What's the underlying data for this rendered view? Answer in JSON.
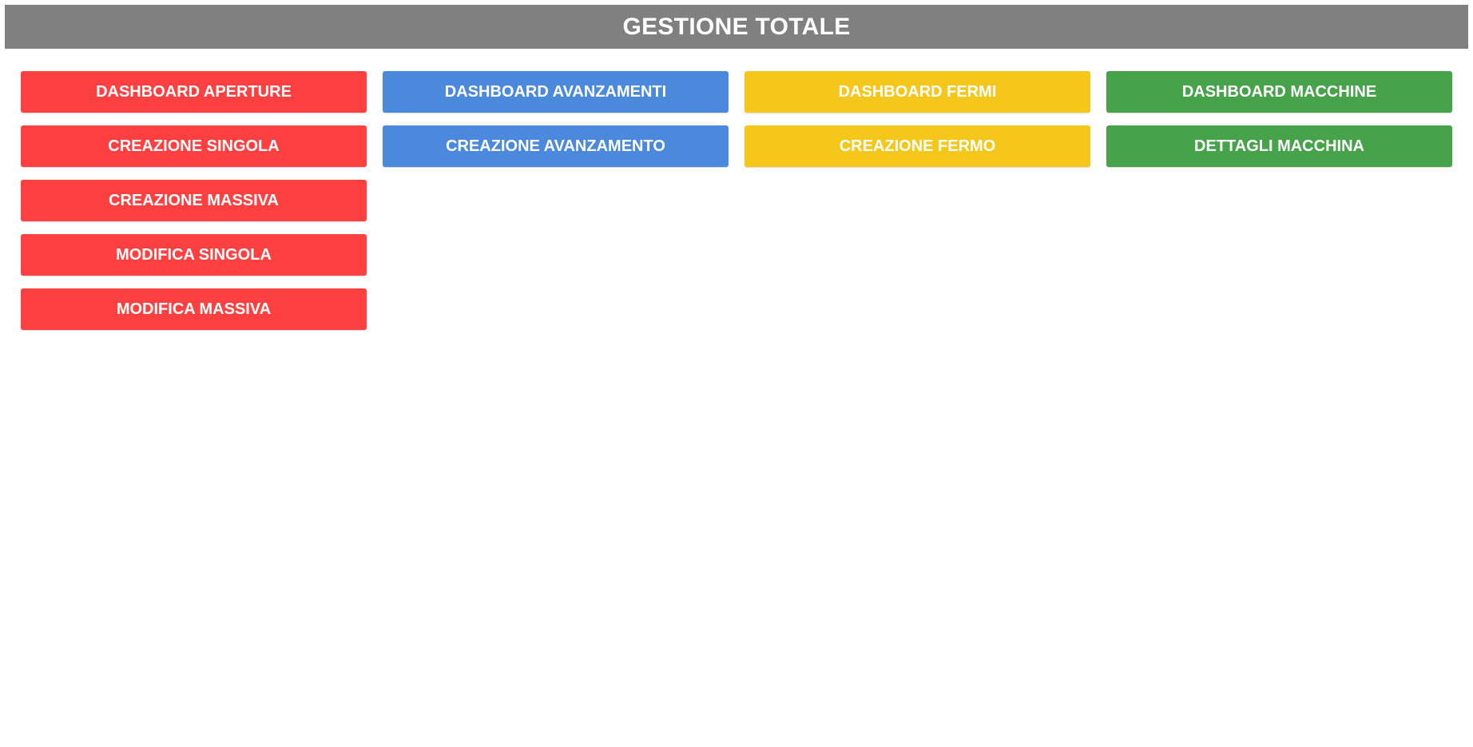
{
  "header": {
    "title": "GESTIONE TOTALE",
    "color": "#808080"
  },
  "columns": [
    {
      "color": "#ff4040",
      "buttons": [
        "DASHBOARD APERTURE",
        "CREAZIONE SINGOLA",
        "CREAZIONE MASSIVA",
        "MODIFICA SINGOLA",
        "MODIFICA MASSIVA"
      ]
    },
    {
      "color": "#4a89dc",
      "buttons": [
        "DASHBOARD AVANZAMENTI",
        "CREAZIONE AVANZAMENTO"
      ]
    },
    {
      "color": "#f5c71a",
      "buttons": [
        "DASHBOARD FERMI",
        "CREAZIONE FERMO"
      ]
    },
    {
      "color": "#46a34a",
      "buttons": [
        "DASHBOARD MACCHINE",
        "DETTAGLI MACCHINA"
      ]
    }
  ]
}
